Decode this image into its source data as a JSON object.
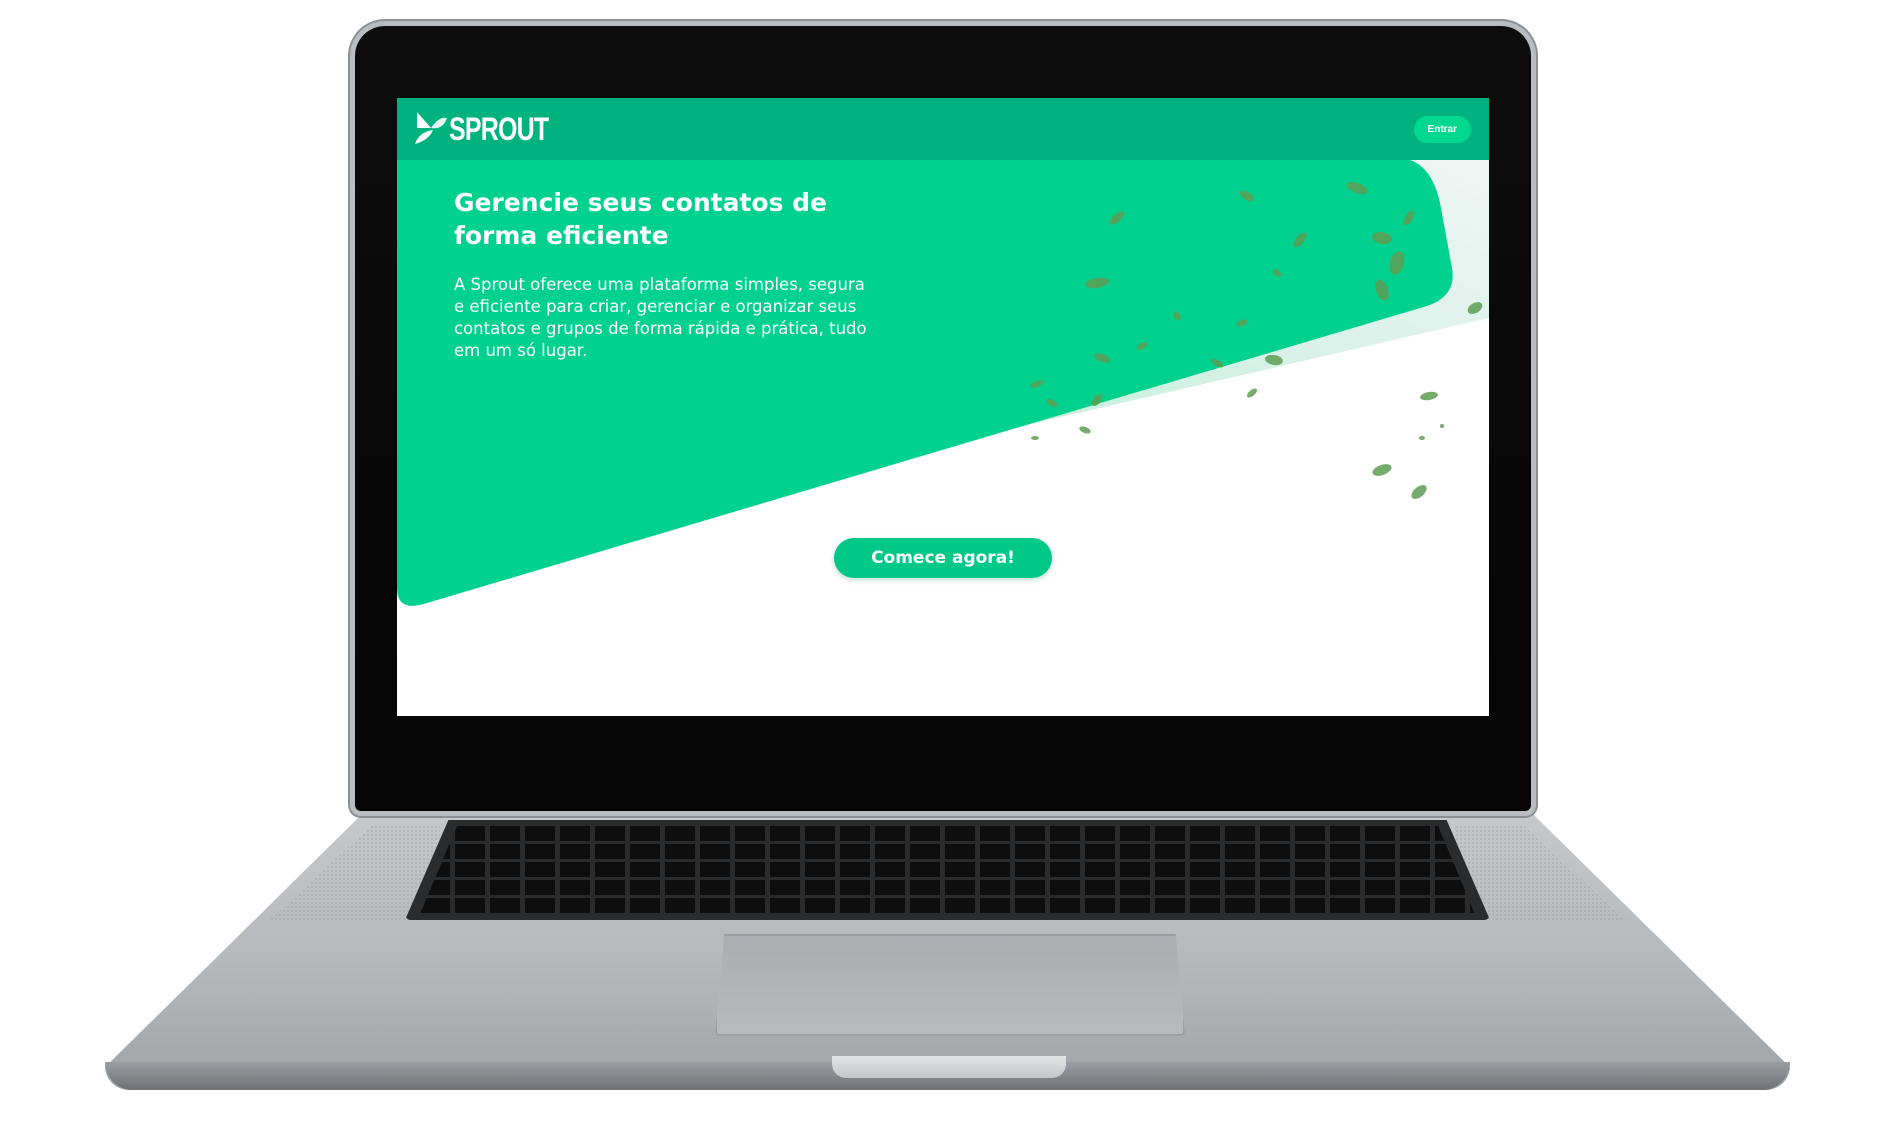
{
  "brand": {
    "name": "SPROUT",
    "primary_color": "#00d18f",
    "nav_color": "#00b37e",
    "accent_light": "#b9f5d8"
  },
  "nav": {
    "login_label": "Entrar"
  },
  "hero": {
    "title": "Gerencie seus contatos de forma eficiente",
    "description": "A Sprout oferece uma plataforma simples, segura e eficiente para criar, gerenciar e organizar seus contatos e grupos de forma rápida e prática, tudo em um só lugar.",
    "cta_label": "Comece agora!"
  },
  "device": {
    "type": "laptop-mockup",
    "icons": [
      "sprout-leaf-logo-icon"
    ]
  }
}
